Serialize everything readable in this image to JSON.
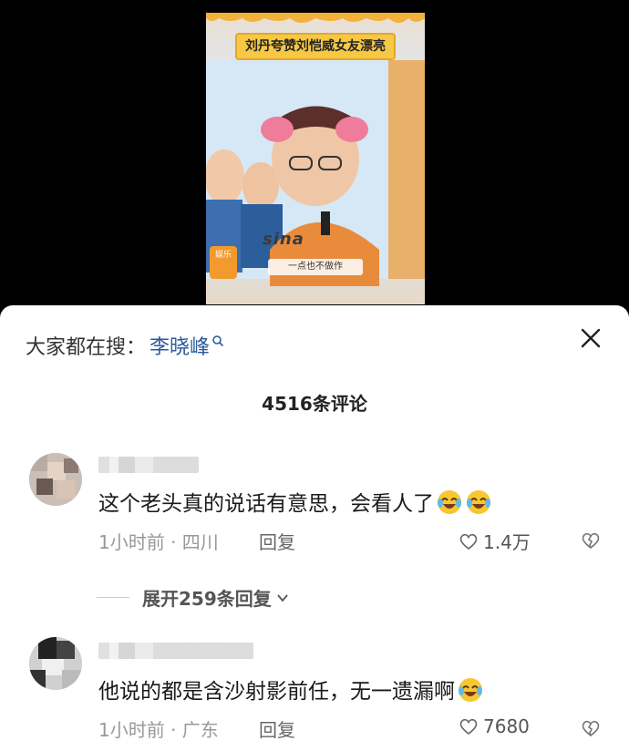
{
  "video": {
    "title_caption": "刘丹夸赞刘恺威女友漂亮",
    "subtitle_caption": "一点也不做作",
    "watermark": "sina",
    "badge": "娱乐"
  },
  "search": {
    "prefix": "大家都在搜：",
    "keyword": "李晓峰"
  },
  "comment_count": "4516条评论",
  "comments": [
    {
      "text": "这个老头真的说话有意思，会看人了",
      "emoji_count": 2,
      "time_location": "1小时前 · 四川",
      "reply_label": "回复",
      "likes": "1.4万"
    },
    {
      "text": "他说的都是含沙射影前任，无一遗漏啊",
      "emoji_count": 1,
      "time_location": "1小时前 · 广东",
      "reply_label": "回复",
      "likes": "7680"
    }
  ],
  "expand_replies": "展开259条回复",
  "colors": {
    "keyword": "#2b5a9a",
    "caption_bg": "#f7c843"
  }
}
